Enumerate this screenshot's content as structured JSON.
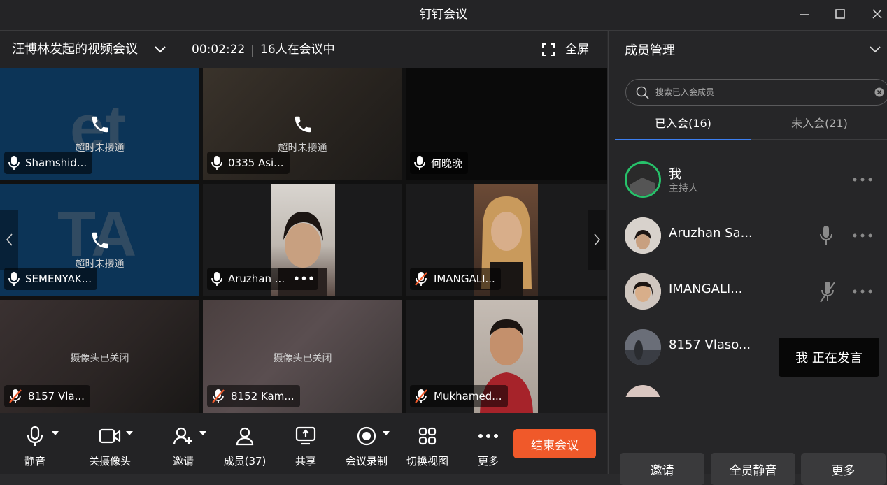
{
  "window": {
    "title": "钉钉会议"
  },
  "meeting": {
    "title": "汪博林发起的视频会议",
    "timer": "00:02:22",
    "participants": "16人在会议中",
    "fullscreen_label": "全屏"
  },
  "tiles": [
    {
      "name": "Shamshid...",
      "status": "超时未接通",
      "watermark": "et",
      "muted": false
    },
    {
      "name": "0335 Asi...",
      "status": "超时未接通",
      "muted": false
    },
    {
      "name": "何晚晚",
      "muted": false
    },
    {
      "name": "SEMENYAK...",
      "status": "超时未接通",
      "watermark": "TA",
      "muted": false
    },
    {
      "name": "Aruzhan ...",
      "muted": false,
      "more": "•••"
    },
    {
      "name": "IMANGALI...",
      "muted": true
    },
    {
      "name": "8157 Vla...",
      "status": "摄像头已关闭",
      "muted": true
    },
    {
      "name": "8152 Kam...",
      "status": "摄像头已关闭",
      "muted": true
    },
    {
      "name": "Mukhamed...",
      "muted": true
    }
  ],
  "toolbar": {
    "mute": "静音",
    "camera": "关摄像头",
    "invite": "邀请",
    "members": "成员(37)",
    "share": "共享",
    "record": "会议录制",
    "switch_view": "切换视图",
    "more": "更多",
    "end": "结束会议"
  },
  "panel": {
    "title": "成员管理",
    "search_placeholder": "搜索已入会成员",
    "tab_joined": "已入会(16)",
    "tab_not_joined": "未入会(21)",
    "members": [
      {
        "name": "我",
        "role": "主持人"
      },
      {
        "name": "Aruzhan Sa..."
      },
      {
        "name": "IMANGALI..."
      },
      {
        "name": "8157 Vlaso..."
      }
    ],
    "tooltip": "我  正在发言",
    "btn_invite": "邀请",
    "btn_mute_all": "全员静音",
    "btn_more": "更多"
  },
  "colors": {
    "accent": "#3c7ff0",
    "end_button": "#f0592a",
    "host_ring": "#27c16a",
    "tile_blue": "#0c3457"
  }
}
